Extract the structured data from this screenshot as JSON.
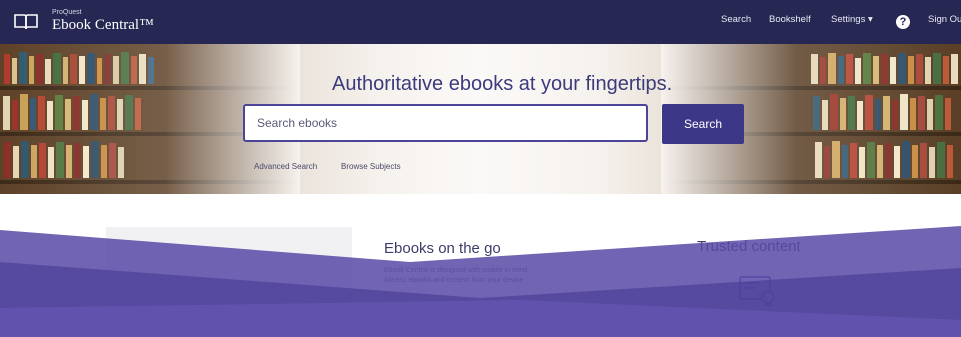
{
  "header": {
    "brand_small": "ProQuest",
    "brand_name": "Ebook Central™",
    "nav": {
      "search": "Search",
      "bookshelf": "Bookshelf",
      "settings": "Settings ▾",
      "help": "?",
      "signout": "Sign Ou"
    }
  },
  "hero": {
    "title": "Authoritative ebooks at your fingertips.",
    "search_placeholder": "Search ebooks",
    "search_button": "Search",
    "links": {
      "advanced": "Advanced Search",
      "browse": "Browse Subjects"
    }
  },
  "cards": {
    "mid": {
      "title": "Ebooks on the go",
      "desc_line1": "Ebook Central is designed with mobile in mind",
      "desc_line2": "Access ebooks and content from your device"
    },
    "right": {
      "title": "Trusted content"
    }
  },
  "colors": {
    "nav_bar": "#262752",
    "accent": "#3c3787",
    "overlay_purple": "#5a4aa6"
  }
}
